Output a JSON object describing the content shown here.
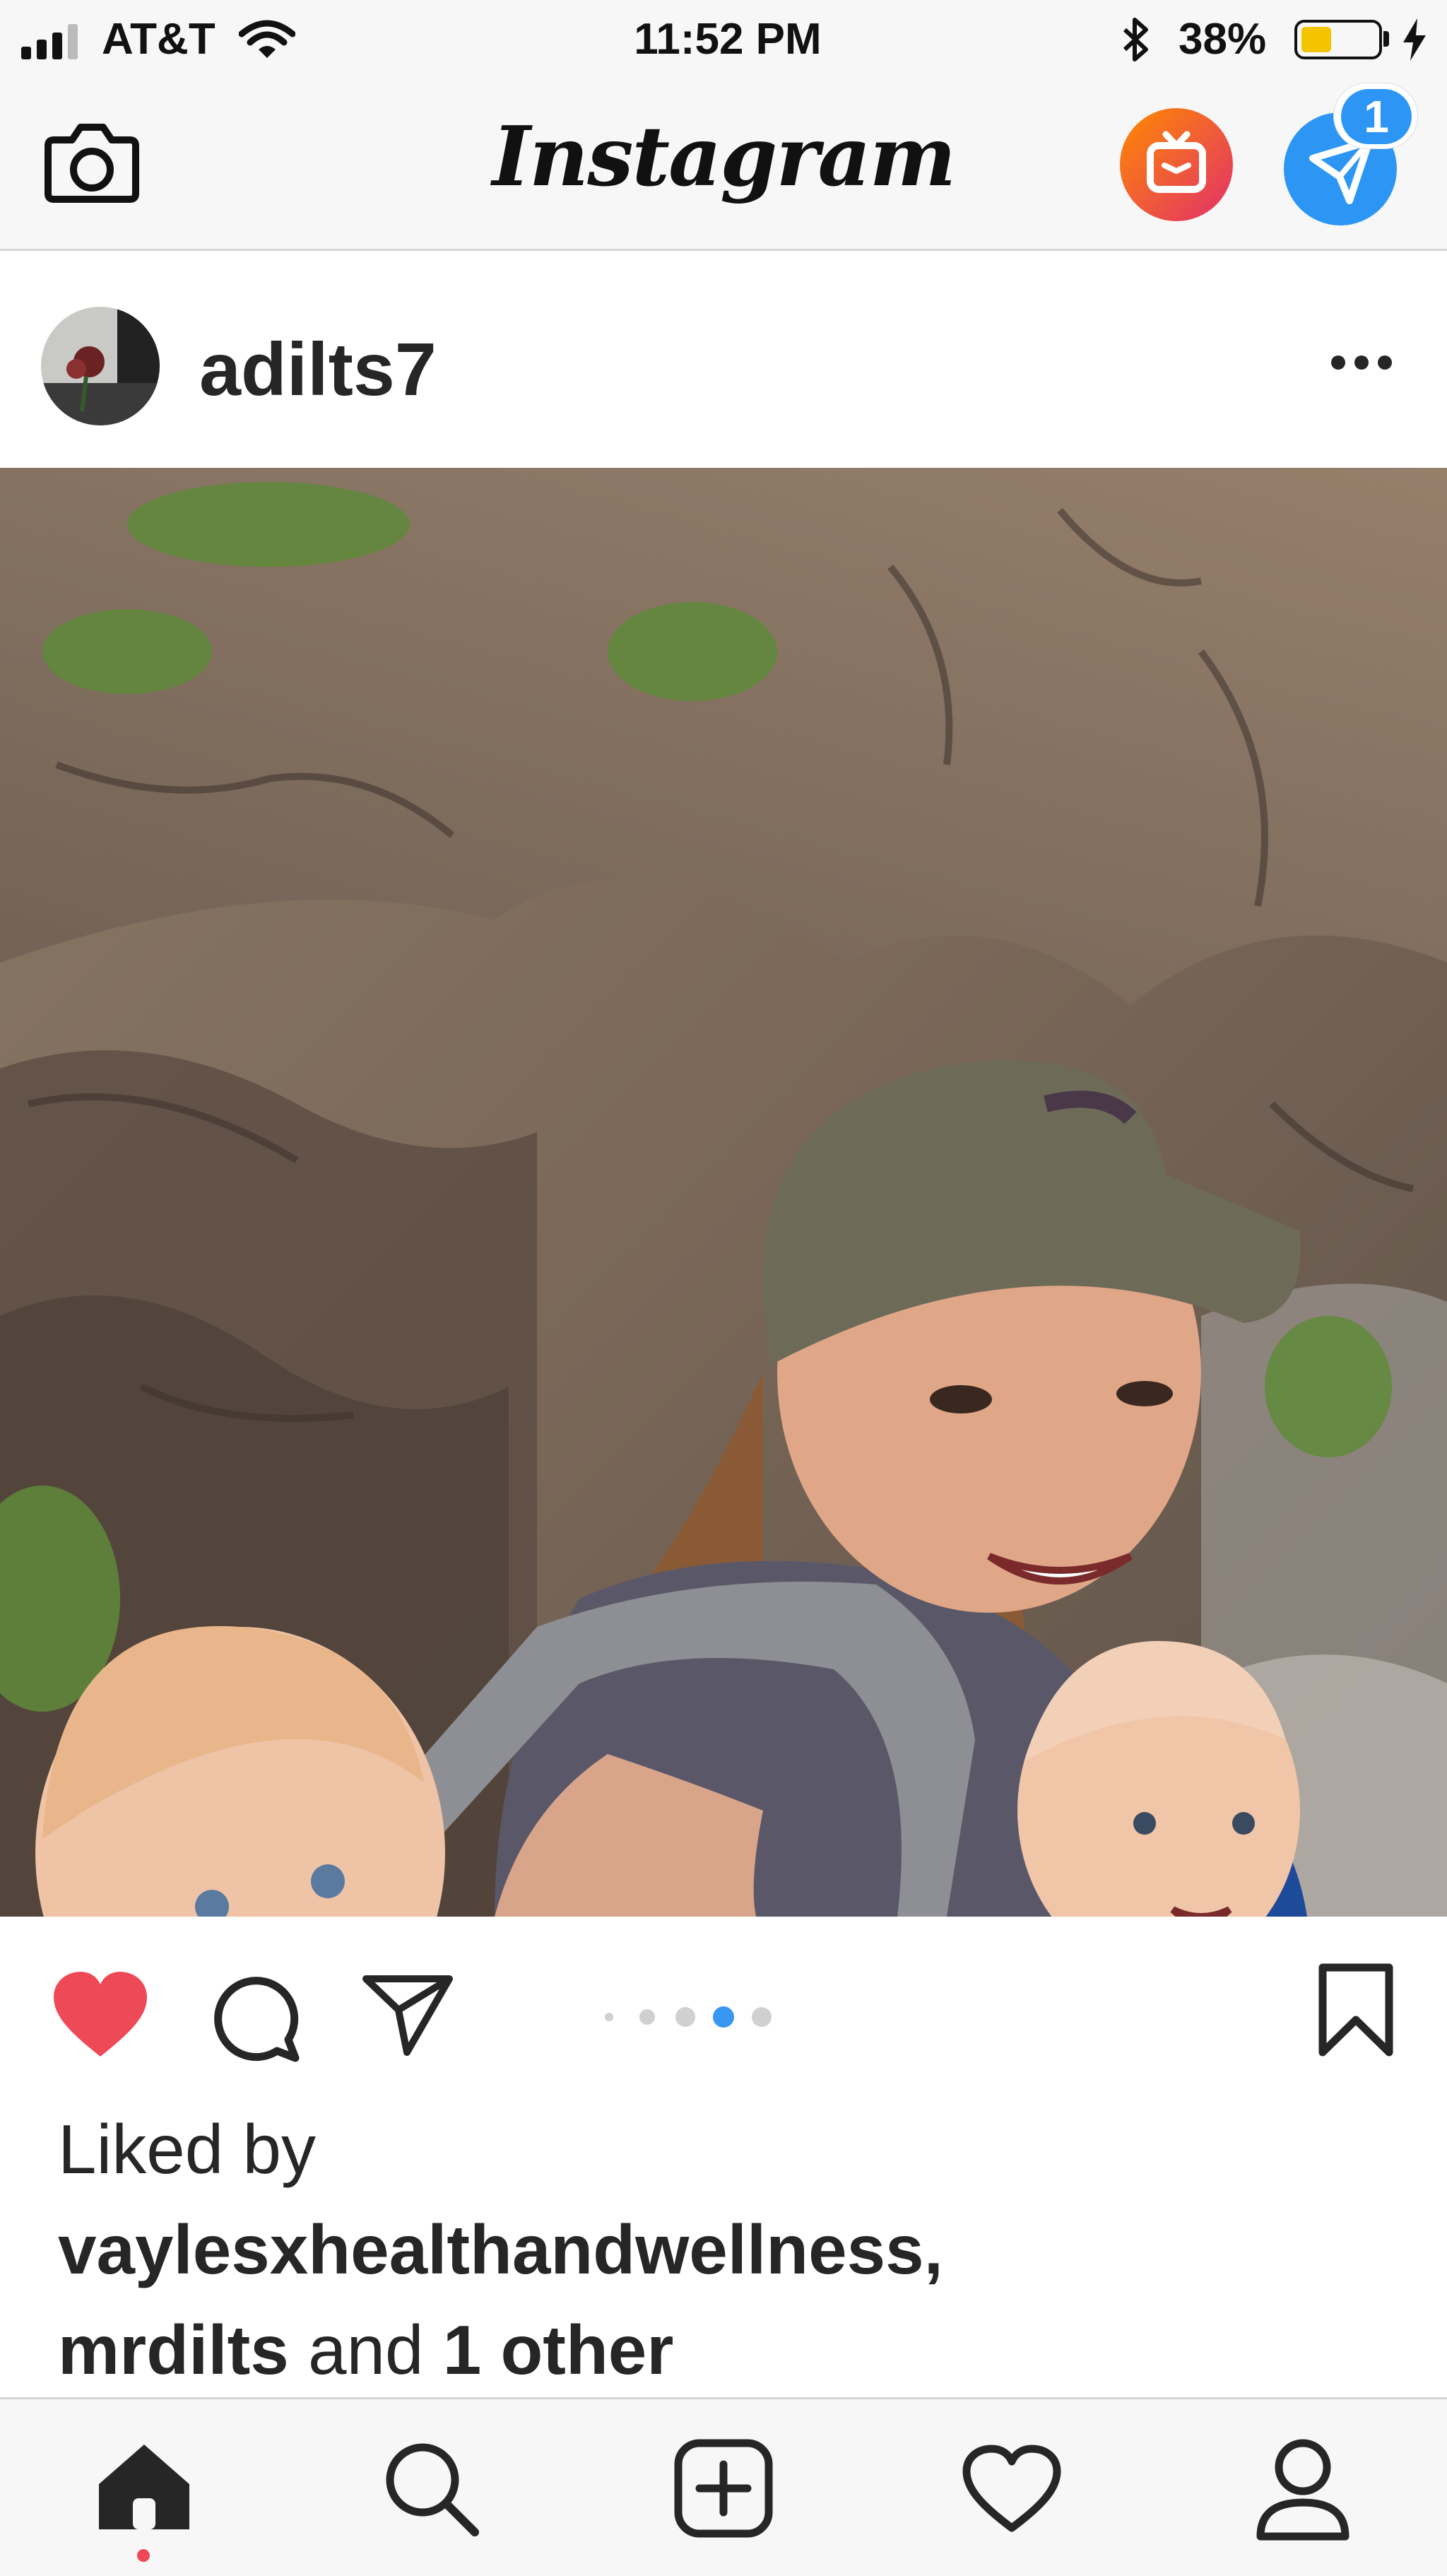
{
  "status_bar": {
    "carrier": "AT&T",
    "time": "11:52 PM",
    "battery": "38%"
  },
  "nav": {
    "logo": "Instagram",
    "dm_badge": "1"
  },
  "post": {
    "username": "adilts7",
    "carousel": {
      "count": 5,
      "active_index": 3
    },
    "liked": true,
    "likes": {
      "prefix": "Liked by",
      "user1": "vaylesxhealthandwellness,",
      "user2": "mrdilts",
      "joiner": "and",
      "others": "1 other"
    }
  },
  "icons": {
    "camera": "camera-icon",
    "igtv": "igtv-icon",
    "direct": "direct-message-icon",
    "more": "more-options-icon",
    "like": "heart-icon",
    "comment": "comment-icon",
    "share": "share-icon",
    "save": "bookmark-icon",
    "home": "home-icon",
    "search": "search-icon",
    "new_post": "add-post-icon",
    "activity": "activity-heart-icon",
    "profile": "profile-icon"
  },
  "colors": {
    "like_red": "#ed4956",
    "active_dot": "#3897f0",
    "battery_yellow": "#f5c400",
    "notification_dot": "#ed4956"
  }
}
